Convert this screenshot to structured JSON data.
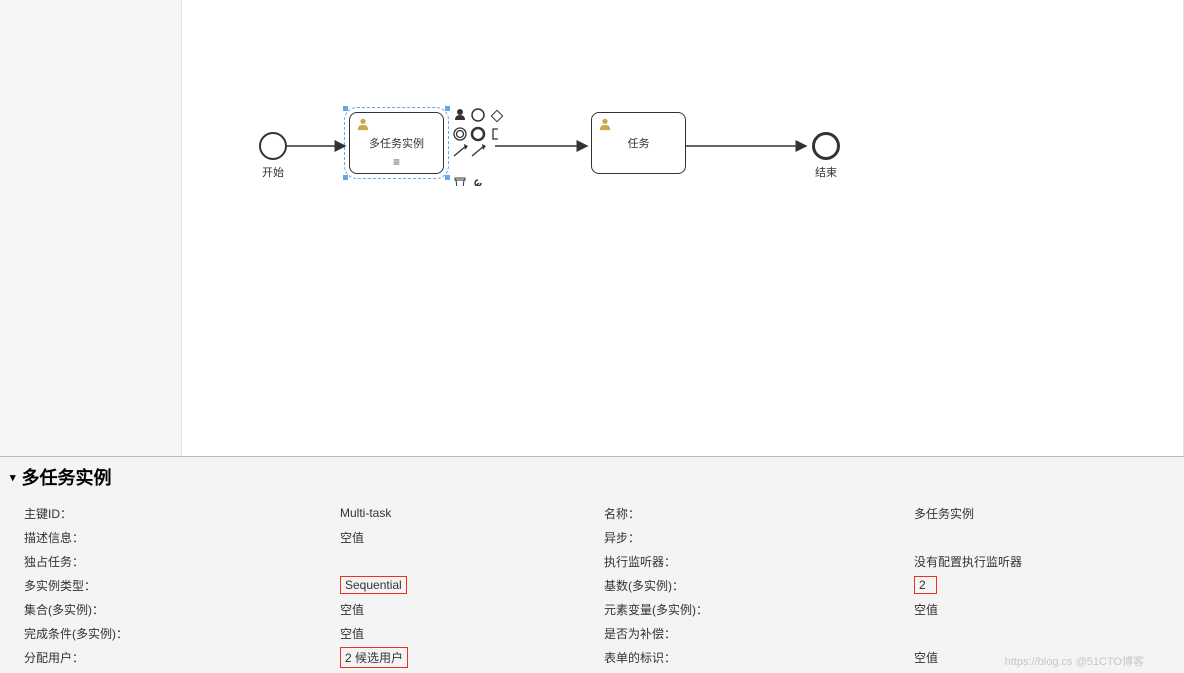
{
  "diagram": {
    "start_label": "开始",
    "end_label": "结束",
    "task1_label": "多任务实例",
    "task2_label": "任务",
    "multi_marker": "≡"
  },
  "panel": {
    "title": "多任务实例"
  },
  "props": {
    "id_label": "主键ID：",
    "id_value": "Multi-task",
    "name_label": "名称：",
    "name_value": "多任务实例",
    "desc_label": "描述信息：",
    "desc_value": "空值",
    "async_label": "异步：",
    "async_value": "",
    "excl_label": "独占任务：",
    "excl_value": "",
    "listener_label": "执行监听器：",
    "listener_value": "没有配置执行监听器",
    "mitype_label": "多实例类型：",
    "mitype_value": "Sequential",
    "card_label": "基数(多实例)：",
    "card_value": "2",
    "coll_label": "集合(多实例)：",
    "coll_value": "空值",
    "elemvar_label": "元素变量(多实例)：",
    "elemvar_value": "空值",
    "compcond_label": "完成条件(多实例)：",
    "compcond_value": "空值",
    "compensate_label": "是否为补偿：",
    "compensate_value": "",
    "assign_label": "分配用户：",
    "assign_value": "2 候选用户",
    "form_label": "表单的标识：",
    "form_value": "空值"
  },
  "watermark": "https://blog.cs @51CTO博客"
}
